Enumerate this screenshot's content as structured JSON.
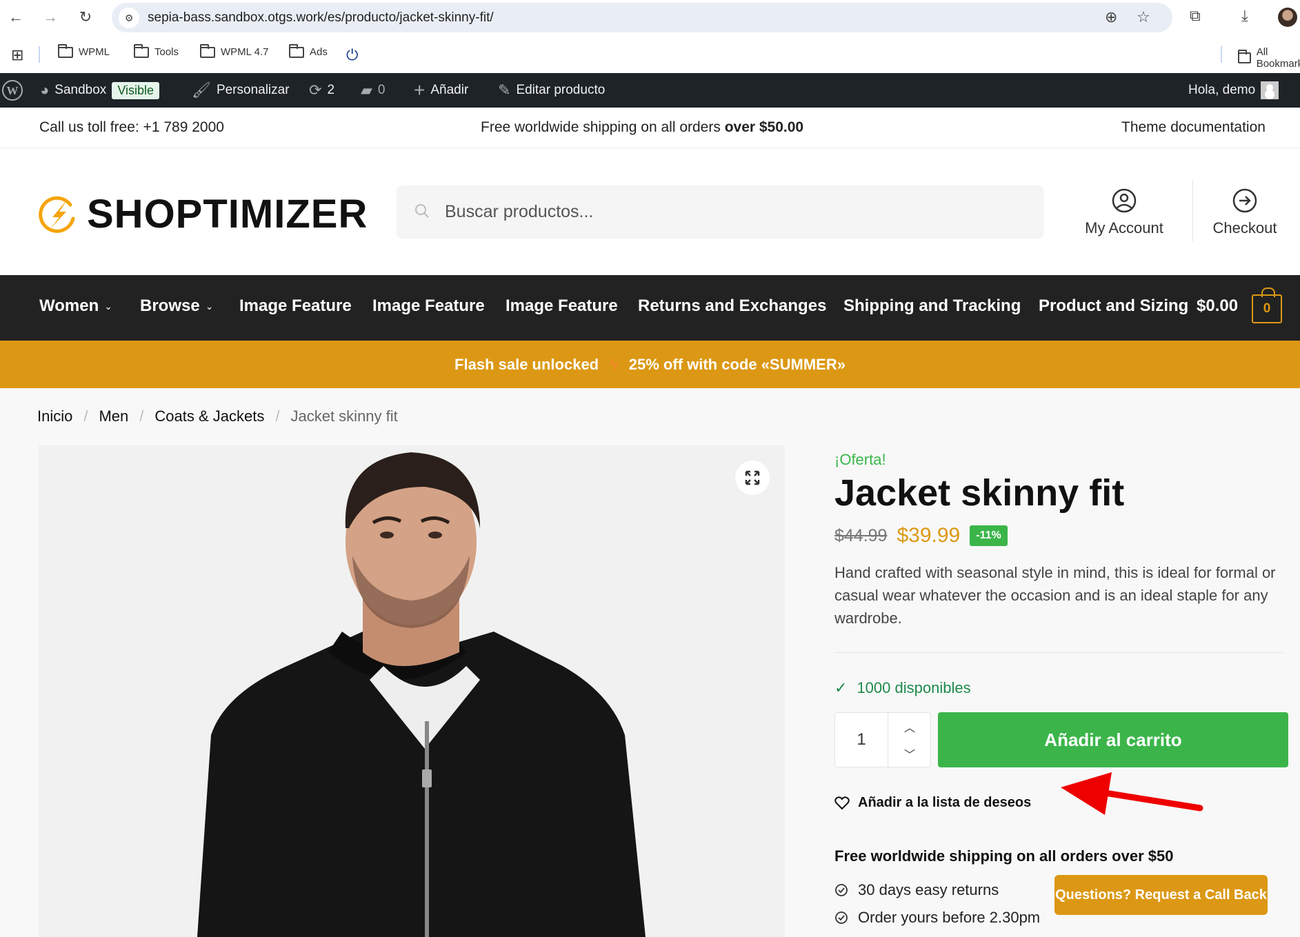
{
  "browser": {
    "url": "sepia-bass.sandbox.otgs.work/es/producto/jacket-skinny-fit/",
    "bookmarks": [
      "WPML",
      "Tools",
      "WPML 4.7",
      "Ads"
    ],
    "all_bookmarks": "All Bookmarks"
  },
  "adminbar": {
    "site": "Sandbox",
    "visible_badge": "Visible",
    "customize": "Personalizar",
    "updates_count": "2",
    "comments_count": "0",
    "add_new": "Añadir",
    "edit_product": "Editar producto",
    "greeting": "Hola, demo"
  },
  "topbar": {
    "phone": "Call us toll free: +1 789 2000",
    "shipping_prefix": "Free worldwide shipping on all orders ",
    "shipping_bold": "over $50.00",
    "docs": "Theme documentation"
  },
  "header": {
    "logo": "SHOPTIMIZER",
    "search_placeholder": "Buscar productos...",
    "my_account": "My Account",
    "checkout": "Checkout"
  },
  "nav": {
    "items": [
      {
        "label": "Women",
        "dropdown": true
      },
      {
        "label": "Browse",
        "dropdown": true
      },
      {
        "label": "Image Feature",
        "dropdown": false
      },
      {
        "label": "Image Feature",
        "dropdown": false
      },
      {
        "label": "Image Feature",
        "dropdown": false
      },
      {
        "label": "Returns and Exchanges",
        "dropdown": false
      },
      {
        "label": "Shipping and Tracking",
        "dropdown": false
      },
      {
        "label": "Product and Sizing",
        "dropdown": false
      }
    ],
    "cart_total": "$0.00",
    "cart_count": "0"
  },
  "flash": {
    "left": "Flash sale unlocked",
    "right": "25% off with code «SUMMER»"
  },
  "breadcrumb": [
    "Inicio",
    "Men",
    "Coats & Jackets",
    "Jacket skinny fit"
  ],
  "product": {
    "sale_label": "¡Oferta!",
    "title": "Jacket skinny fit",
    "regular_price": "$44.99",
    "sale_price": "$39.99",
    "discount": "-11%",
    "description": "Hand crafted with seasonal style in mind, this is ideal for formal or casual wear whatever the occasion and is an ideal staple for any wardrobe.",
    "stock": "1000 disponibles",
    "quantity": "1",
    "add_to_cart": "Añadir al carrito",
    "wishlist": "Añadir a la lista de deseos",
    "shipping_title": "Free worldwide shipping on all orders over $50",
    "perks": [
      "30 days easy returns",
      "Order yours before 2.30pm"
    ]
  },
  "callback_button": "Questions? Request a Call Back",
  "colors": {
    "accent": "#dc9814",
    "green": "#3bb54a",
    "nav_bg": "#222222",
    "adminbar_bg": "#1d2327"
  }
}
